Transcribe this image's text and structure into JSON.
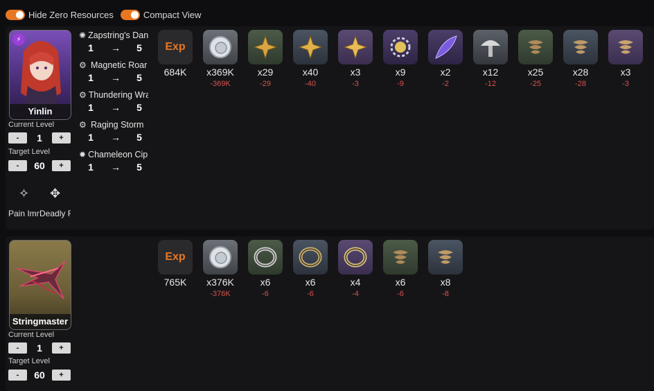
{
  "toggles": [
    {
      "label": "Hide Zero Resources",
      "on": true
    },
    {
      "label": "Compact View",
      "on": true
    }
  ],
  "characters": [
    {
      "name": "Yinlin",
      "element_icon": "electro-icon",
      "current_level_label": "Current Level",
      "current_level": "1",
      "target_level_label": "Target Level",
      "target_level": "60",
      "minus": "-",
      "plus": "+",
      "skills": [
        {
          "name": "Zapstring's Dance",
          "icon": "zap-icon",
          "from": "1",
          "arrow": "→",
          "to": "5"
        },
        {
          "name": "Magnetic Roar",
          "icon": "gear-icon",
          "from": "1",
          "arrow": "→",
          "to": "5"
        },
        {
          "name": "Thundering Wrath",
          "icon": "gear-icon",
          "from": "1",
          "arrow": "→",
          "to": "5"
        },
        {
          "name": "Raging Storm",
          "icon": "gear-icon",
          "from": "1",
          "arrow": "→",
          "to": "5"
        },
        {
          "name": "Chameleon Cipher",
          "icon": "bulb-icon",
          "from": "1",
          "arrow": "→",
          "to": "5"
        }
      ],
      "passives": [
        {
          "name": "Pain Immersion",
          "icon": "diamond-icon"
        },
        {
          "name": "Deadly Focus",
          "icon": "burst-icon"
        }
      ],
      "resources": [
        {
          "icon": "exp-icon",
          "text": "Exp",
          "count": "684K",
          "delta": ""
        },
        {
          "icon": "shell-credit-icon",
          "count": "x369K",
          "delta": "-369K"
        },
        {
          "icon": "star-crystal-icon",
          "count": "x29",
          "delta": "-29"
        },
        {
          "icon": "star-crystal-icon",
          "count": "x40",
          "delta": "-40"
        },
        {
          "icon": "star-crystal-icon",
          "count": "x3",
          "delta": "-3"
        },
        {
          "icon": "gear-core-icon",
          "count": "x9",
          "delta": "-9"
        },
        {
          "icon": "feather-icon",
          "count": "x2",
          "delta": "-2"
        },
        {
          "icon": "mushroom-icon",
          "count": "x12",
          "delta": "-12"
        },
        {
          "icon": "spiral-icon",
          "count": "x25",
          "delta": "-25"
        },
        {
          "icon": "spiral-icon",
          "count": "x28",
          "delta": "-28"
        },
        {
          "icon": "spiral-icon",
          "count": "x3",
          "delta": "-3"
        }
      ]
    },
    {
      "name": "Stringmaster",
      "current_level_label": "Current Level",
      "current_level": "1",
      "target_level_label": "Target Level",
      "target_level": "60",
      "minus": "-",
      "plus": "+",
      "resources": [
        {
          "icon": "exp-icon",
          "text": "Exp",
          "count": "765K",
          "delta": ""
        },
        {
          "icon": "shell-credit-icon",
          "count": "x376K",
          "delta": "-376K"
        },
        {
          "icon": "ring-icon",
          "count": "x6",
          "delta": "-6"
        },
        {
          "icon": "ring-icon",
          "count": "x6",
          "delta": "-6"
        },
        {
          "icon": "ring-icon",
          "count": "x4",
          "delta": "-4"
        },
        {
          "icon": "spiral-icon",
          "count": "x6",
          "delta": "-6"
        },
        {
          "icon": "spiral-icon",
          "count": "x8",
          "delta": "-8"
        }
      ]
    }
  ],
  "colors": {
    "accent": "#e87722",
    "delta": "#d9534f",
    "background": "#0e0e10",
    "card": "#151517"
  }
}
